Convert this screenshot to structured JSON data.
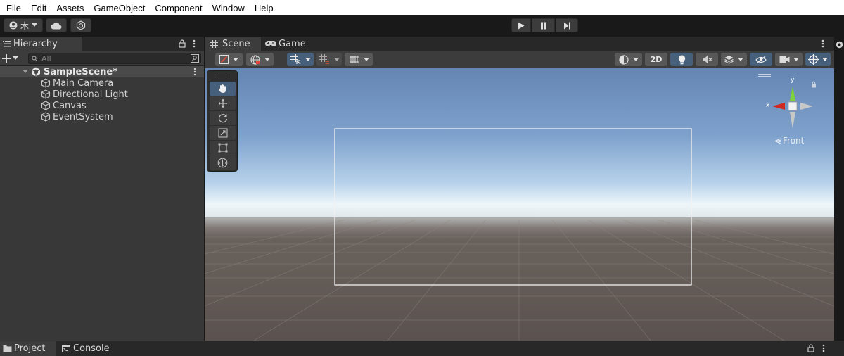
{
  "menu": [
    "File",
    "Edit",
    "Assets",
    "GameObject",
    "Component",
    "Window",
    "Help"
  ],
  "toolbar": {
    "account_label": "木",
    "play_icon": "play-icon",
    "pause_icon": "pause-icon",
    "step_icon": "step-icon"
  },
  "hierarchy": {
    "tab_label": "Hierarchy",
    "search_placeholder": "All",
    "scene_name": "SampleScene*",
    "objects": [
      "Main Camera",
      "Directional Light",
      "Canvas",
      "EventSystem"
    ]
  },
  "scene": {
    "tabs": [
      "Scene",
      "Game"
    ],
    "mode_2d_label": "2D",
    "gizmo_label": "Front",
    "axis_y": "y",
    "axis_x": "x"
  },
  "bottom": {
    "tabs": [
      "Project",
      "Console"
    ]
  }
}
